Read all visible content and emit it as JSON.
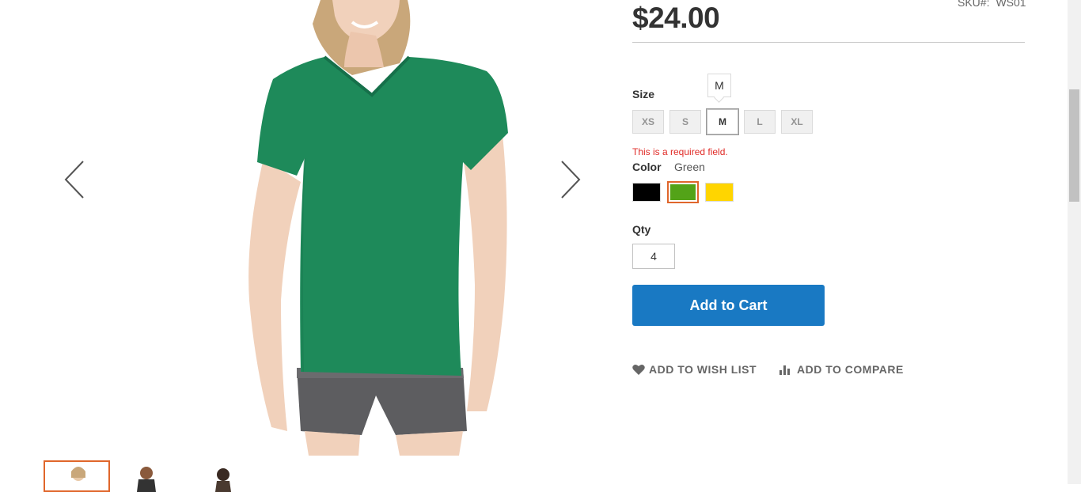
{
  "product": {
    "price": "$24.00",
    "sku_label": "SKU#:",
    "sku_value": "WS01"
  },
  "size": {
    "label": "Size",
    "tooltip": "M",
    "options": [
      "XS",
      "S",
      "M",
      "L",
      "XL"
    ],
    "selected": "M"
  },
  "validation": {
    "error": "This is a required field."
  },
  "color": {
    "label": "Color",
    "selected_value": "Green",
    "options": [
      {
        "name": "Black",
        "hex": "#000000"
      },
      {
        "name": "Green",
        "hex": "#53a318"
      },
      {
        "name": "Yellow",
        "hex": "#ffd500"
      }
    ]
  },
  "qty": {
    "label": "Qty",
    "value": "4"
  },
  "actions": {
    "add_to_cart": "Add to Cart",
    "add_to_wishlist": "ADD TO WISH LIST",
    "add_to_compare": "ADD TO COMPARE"
  },
  "colors": {
    "primary": "#1979c3",
    "accent": "#e0662b",
    "error": "#e02b27",
    "shirt": "#1e8a5a"
  },
  "icons": {
    "prev": "chevron-left-icon",
    "next": "chevron-right-icon",
    "wishlist": "heart-icon",
    "compare": "bar-chart-icon"
  }
}
